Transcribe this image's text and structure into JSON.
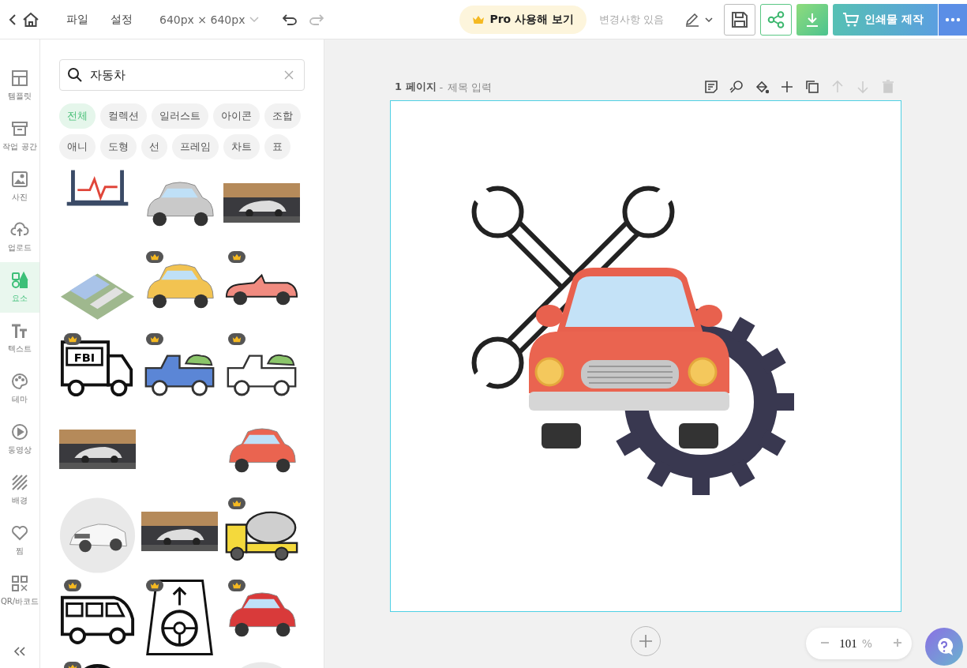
{
  "toolbar": {
    "menu": [
      {
        "label": "파일"
      },
      {
        "label": "설정"
      }
    ],
    "size": "640px × 640px",
    "undo_disabled": false,
    "redo_disabled": true,
    "pro_button": "Pro 사용해 보기",
    "status": "변경사항 있음",
    "print_button": "인쇄물 제작"
  },
  "sidebar": {
    "items": [
      {
        "label": "템플릿",
        "selected": false
      },
      {
        "label": "작업 공간",
        "selected": false
      },
      {
        "label": "사진",
        "selected": false
      },
      {
        "label": "업로드",
        "selected": false
      },
      {
        "label": "요소",
        "selected": true
      },
      {
        "label": "텍스트",
        "selected": false
      },
      {
        "label": "테마",
        "selected": false
      },
      {
        "label": "동영상",
        "selected": false
      },
      {
        "label": "배경",
        "selected": false
      },
      {
        "label": "찜",
        "selected": false
      },
      {
        "label": "QR/바코드",
        "selected": false
      }
    ]
  },
  "panel": {
    "search": {
      "value": "자동차"
    },
    "filters": [
      {
        "label": "전체",
        "selected": true
      },
      {
        "label": "컬렉션",
        "selected": false
      },
      {
        "label": "일러스트",
        "selected": false
      },
      {
        "label": "아이콘",
        "selected": false
      },
      {
        "label": "조합",
        "selected": false
      },
      {
        "label": "애니",
        "selected": false
      },
      {
        "label": "도형",
        "selected": false
      },
      {
        "label": "선",
        "selected": false
      },
      {
        "label": "프레임",
        "selected": false
      },
      {
        "label": "차트",
        "selected": false
      },
      {
        "label": "표",
        "selected": false
      }
    ],
    "results": [
      {
        "kind": "monitor",
        "pro": false
      },
      {
        "kind": "car",
        "color": "#c9c9c9",
        "pro": false
      },
      {
        "kind": "picture",
        "pro": false
      },
      {
        "kind": "city",
        "pro": false
      },
      {
        "kind": "car",
        "color": "#f2c351",
        "pro": true
      },
      {
        "kind": "convertible",
        "color": "#f08b80",
        "pro": true
      },
      {
        "kind": "label-truck",
        "label": "FBI",
        "pro": true
      },
      {
        "kind": "pickup",
        "color": "#5b86d6",
        "pro": true
      },
      {
        "kind": "pickup",
        "color": "#ffffff",
        "pro": true
      },
      {
        "kind": "picture",
        "pro": false
      },
      {
        "kind": "blank"
      },
      {
        "kind": "car",
        "color": "#ea6450",
        "pro": false
      },
      {
        "kind": "round-picture",
        "pro": false
      },
      {
        "kind": "picture",
        "pro": false
      },
      {
        "kind": "mixer",
        "pro": true
      },
      {
        "kind": "bus",
        "pro": true
      },
      {
        "kind": "steering",
        "pro": true
      },
      {
        "kind": "car",
        "color": "#d93a3a",
        "pro": true
      },
      {
        "kind": "wheel",
        "pro": true
      },
      {
        "kind": "blank"
      },
      {
        "kind": "round-picture",
        "pro": false
      }
    ]
  },
  "page": {
    "number_label": "1 페이지",
    "separator": "-",
    "title_placeholder": "제목 입력",
    "tools": [
      {
        "disabled": false
      },
      {
        "disabled": false
      },
      {
        "disabled": false
      },
      {
        "disabled": false
      },
      {
        "disabled": false
      },
      {
        "disabled": true
      },
      {
        "disabled": true
      },
      {
        "disabled": true
      }
    ]
  },
  "zoom": {
    "value": "101",
    "unit": "%"
  }
}
